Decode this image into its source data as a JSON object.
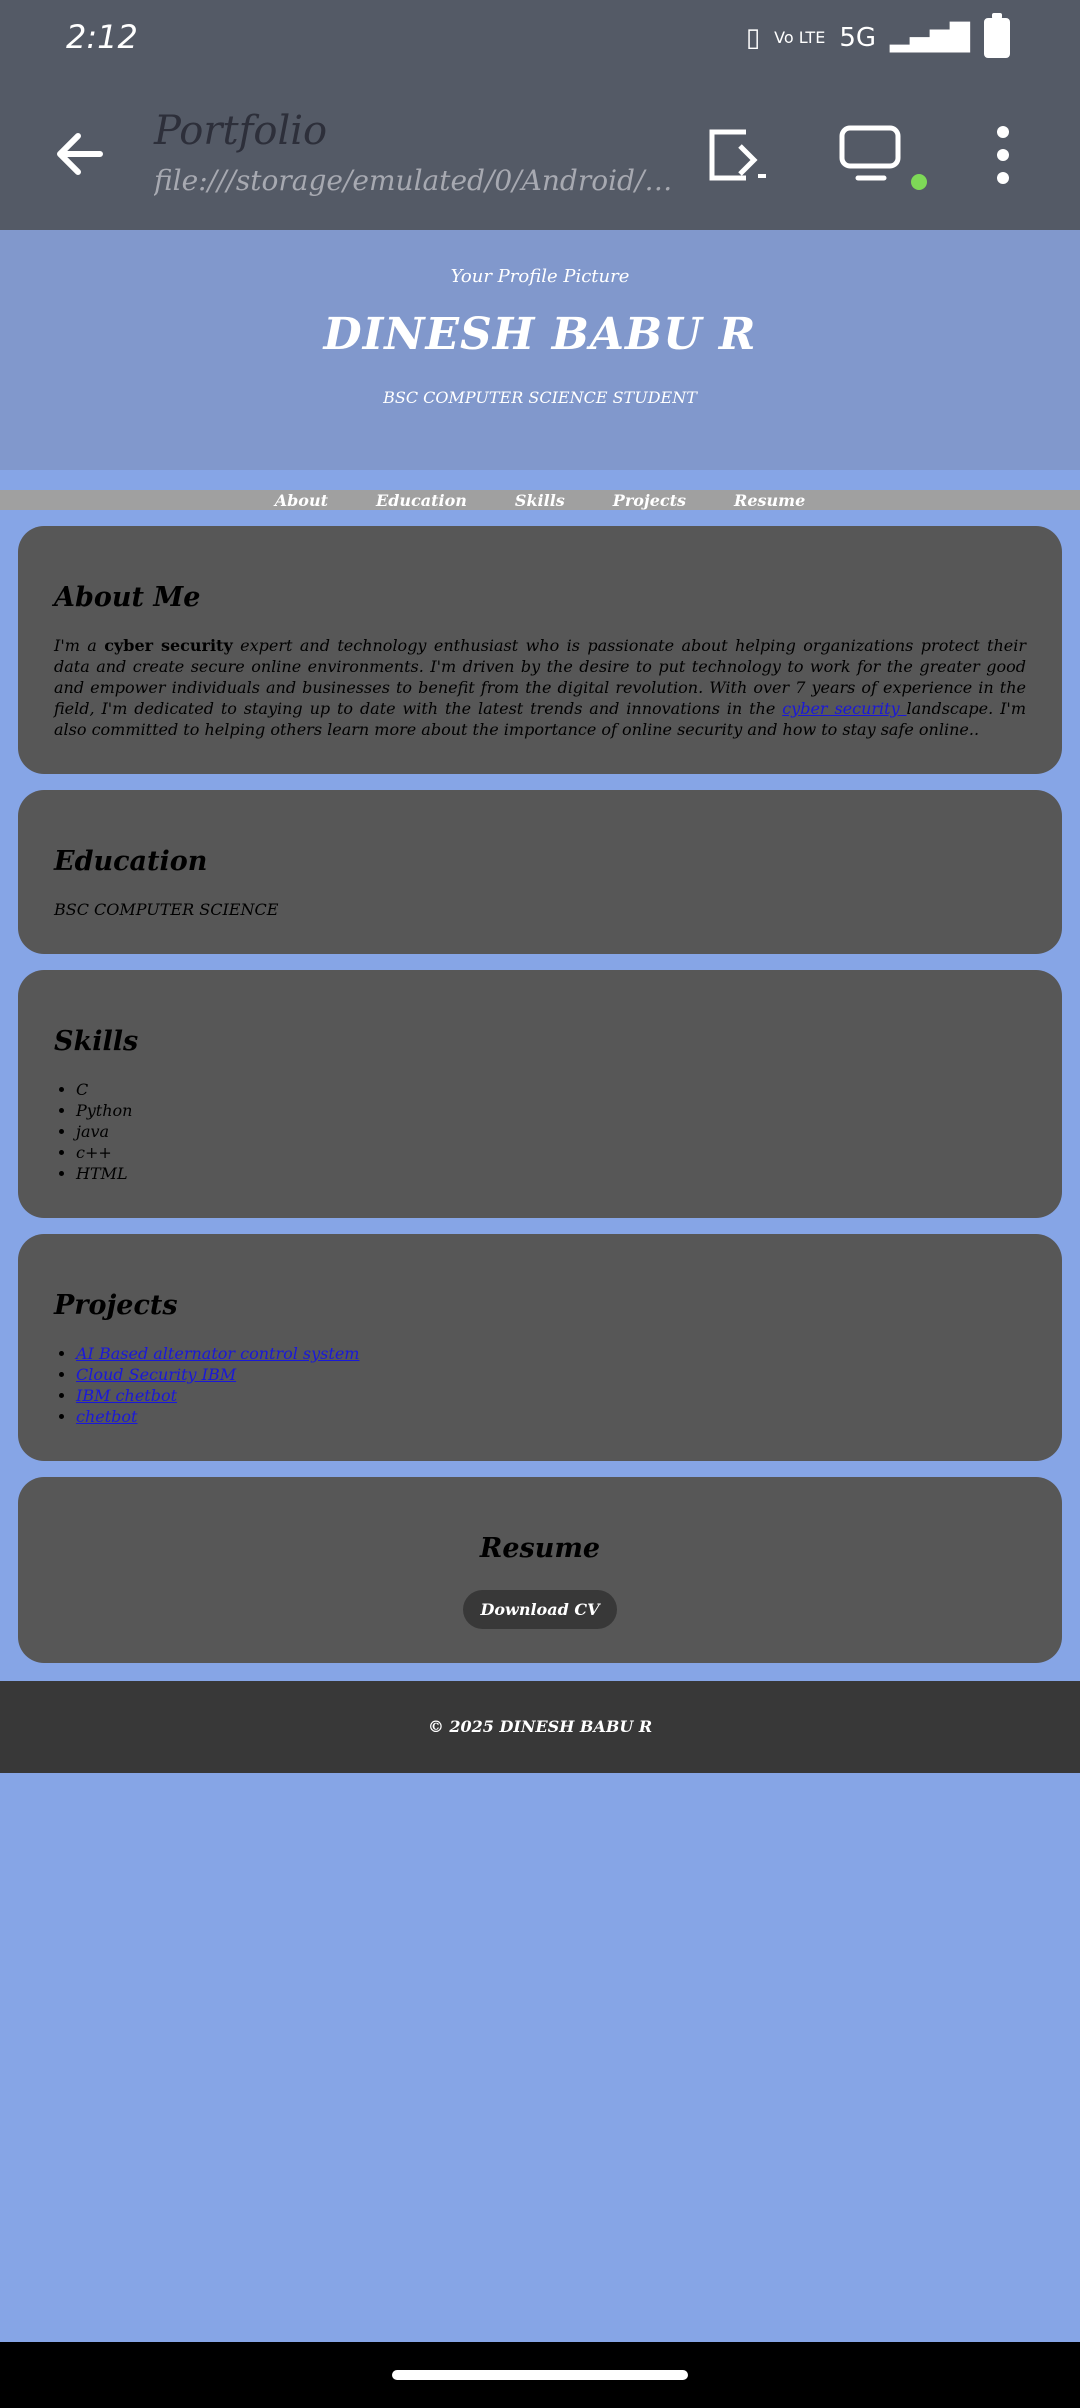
{
  "status": {
    "time": "2:12",
    "network": "5G",
    "volte": "Vo LTE"
  },
  "browser": {
    "title": "Portfolio",
    "url": "file:///storage/emulated/0/Android/d..."
  },
  "hero": {
    "profile_alt": "Your Profile Picture",
    "name": "DINESH BABU R",
    "role": "BSC COMPUTER SCIENCE STUDENT"
  },
  "nav": [
    "About",
    "Education",
    "Skills",
    "Projects",
    "Resume"
  ],
  "about": {
    "heading": "About Me",
    "text_pre": "I'm a ",
    "highlight": "cyber security",
    "text_mid": " expert and technology enthusiast who is passionate about helping organizations protect their data and create secure online environments. I'm driven by the desire to put technology to work for the greater good and empower individuals and businesses to benefit from the digital revolution. With over 7 years of experience in the field, I'm dedicated to staying up to date with the latest trends and innovations in the ",
    "link": "cyber security ",
    "text_post": "landscape. I'm also committed to helping others learn more about the importance of online security and how to stay safe online.."
  },
  "education": {
    "heading": "Education",
    "text": "BSC COMPUTER SCIENCE"
  },
  "skills": {
    "heading": "Skills",
    "items": [
      "C",
      "Python",
      "java",
      "c++",
      "HTML"
    ]
  },
  "projects": {
    "heading": "Projects",
    "items": [
      "AI Based alternator control system",
      "Cloud Security IBM",
      "IBM chetbot",
      "chetbot"
    ]
  },
  "resume": {
    "heading": "Resume",
    "button": "Download CV"
  },
  "footer": {
    "text": "© 2025 DINESH BABU R"
  },
  "colors": {
    "page_bg": "#86a5e6",
    "section_bg": "#575757",
    "chrome": "#545a66",
    "link": "#1a18d9"
  }
}
